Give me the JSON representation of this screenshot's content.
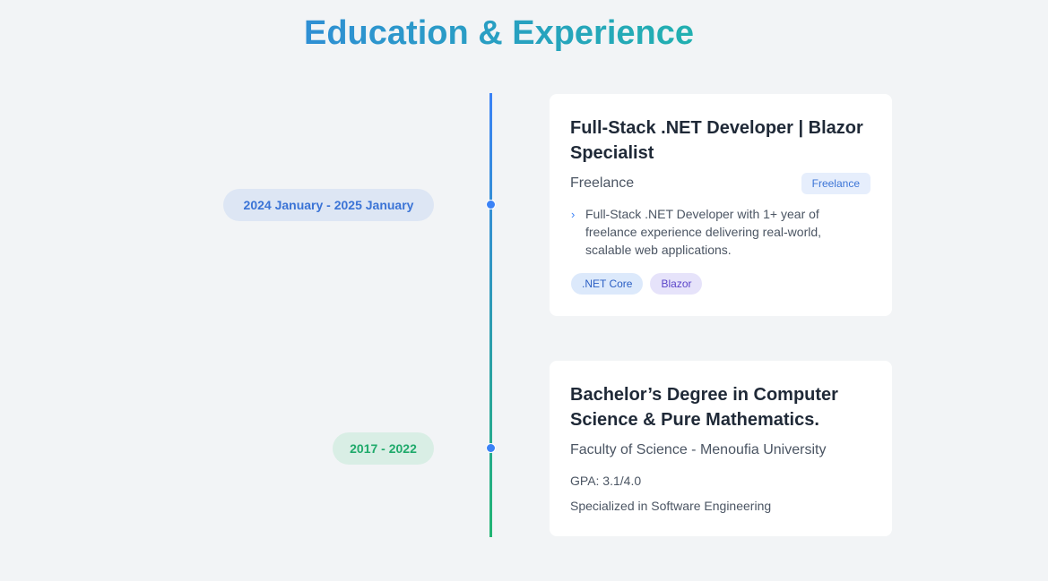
{
  "section": {
    "title": "Education & Experience"
  },
  "colors": {
    "title_gradient_start": "#2f8fd4",
    "title_gradient_end": "#22b0b0",
    "timeline_top": "#3b82f6",
    "timeline_bottom": "#22b573",
    "background": "#f2f4f6"
  },
  "timeline": [
    {
      "date": "2024 January - 2025 January",
      "title": "Full-Stack .NET Developer | Blazor Specialist",
      "organization": "Freelance",
      "badge": "Freelance",
      "bullets": [
        "Full-Stack .NET Developer with 1+ year of freelance experience delivering real-world, scalable web applications."
      ],
      "bullet_icon": "chevron-right-icon",
      "tags": [
        ".NET Core",
        "Blazor"
      ]
    },
    {
      "date": "2017 - 2022",
      "title": "Bachelor’s Degree in Computer Science & Pure Mathematics.",
      "organization": "Faculty of Science - Menoufia University",
      "gpa": "GPA: 3.1/4.0",
      "specialization": "Specialized in Software Engineering"
    }
  ]
}
